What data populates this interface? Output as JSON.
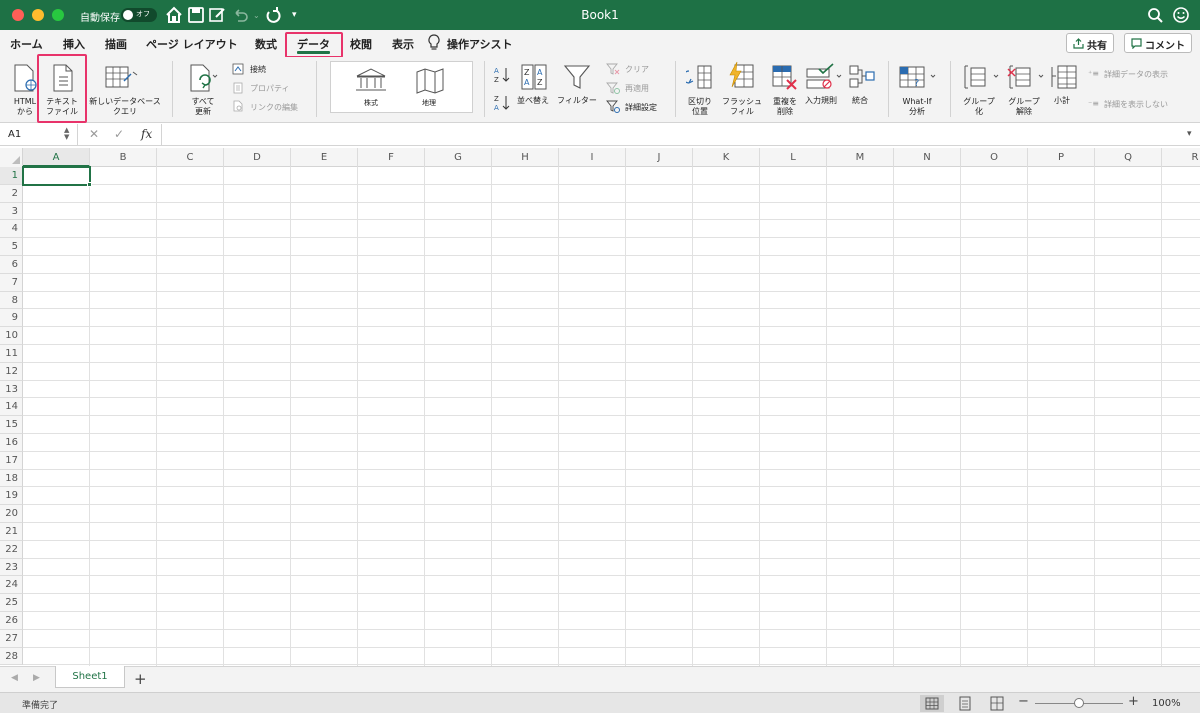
{
  "window": {
    "title": "Book1",
    "autosave_label": "自動保存",
    "autosave_state": "オフ"
  },
  "tabs": [
    {
      "label": "ホーム"
    },
    {
      "label": "挿入"
    },
    {
      "label": "描画"
    },
    {
      "label": "ページ レイアウト"
    },
    {
      "label": "数式"
    },
    {
      "label": "データ"
    },
    {
      "label": "校閲"
    },
    {
      "label": "表示"
    },
    {
      "label": "操作アシスト"
    }
  ],
  "active_tab": "データ",
  "share_button": "共有",
  "comment_button": "コメント",
  "ribbon": {
    "html_line1": "HTML",
    "html_line2": "から",
    "text_file_line1": "テキスト",
    "text_file_line2": "ファイル",
    "new_query_line1": "新しいデータベース",
    "new_query_line2": "クエリ",
    "refresh_line1": "すべて",
    "refresh_line2": "更新",
    "connections": "接続",
    "properties": "プロパティ",
    "edit_links": "リンクの編集",
    "stocks": "株式",
    "geography": "地理",
    "sort": "並べ替え",
    "filter": "フィルター",
    "clear": "クリア",
    "reapply": "再適用",
    "advanced": "詳細設定",
    "text_to_columns_line1": "区切り",
    "text_to_columns_line2": "位置",
    "flash_fill_line1": "フラッシュ",
    "flash_fill_line2": "フィル",
    "remove_duplicates_line1": "重複を",
    "remove_duplicates_line2": "削除",
    "data_validation": "入力規則",
    "consolidate": "統合",
    "what_if_line1": "What-If",
    "what_if_line2": "分析",
    "group_line1": "グループ",
    "group_line2": "化",
    "ungroup_line1": "グループ",
    "ungroup_line2": "解除",
    "subtotal": "小計",
    "show_detail": "詳細データの表示",
    "hide_detail": "詳細を表示しない"
  },
  "formula_bar": {
    "name_box": "A1",
    "fx": "fx"
  },
  "columns": [
    "A",
    "B",
    "C",
    "D",
    "E",
    "F",
    "G",
    "H",
    "I",
    "J",
    "K",
    "L",
    "M",
    "N",
    "O",
    "P",
    "Q",
    "R"
  ],
  "rows": [
    "1",
    "2",
    "3",
    "4",
    "5",
    "6",
    "7",
    "8",
    "9",
    "10",
    "11",
    "12",
    "13",
    "14",
    "15",
    "16",
    "17",
    "18",
    "19",
    "20",
    "21",
    "22",
    "23",
    "24",
    "25",
    "26",
    "27",
    "28"
  ],
  "selected_cell": "A1",
  "sheets": [
    {
      "name": "Sheet1"
    }
  ],
  "status": {
    "text": "準備完了",
    "zoom": "100%",
    "zoom_fraction": 0.5
  },
  "colors": {
    "brand": "#1e7145",
    "accent": "#217346",
    "highlight": "#e8336a"
  }
}
